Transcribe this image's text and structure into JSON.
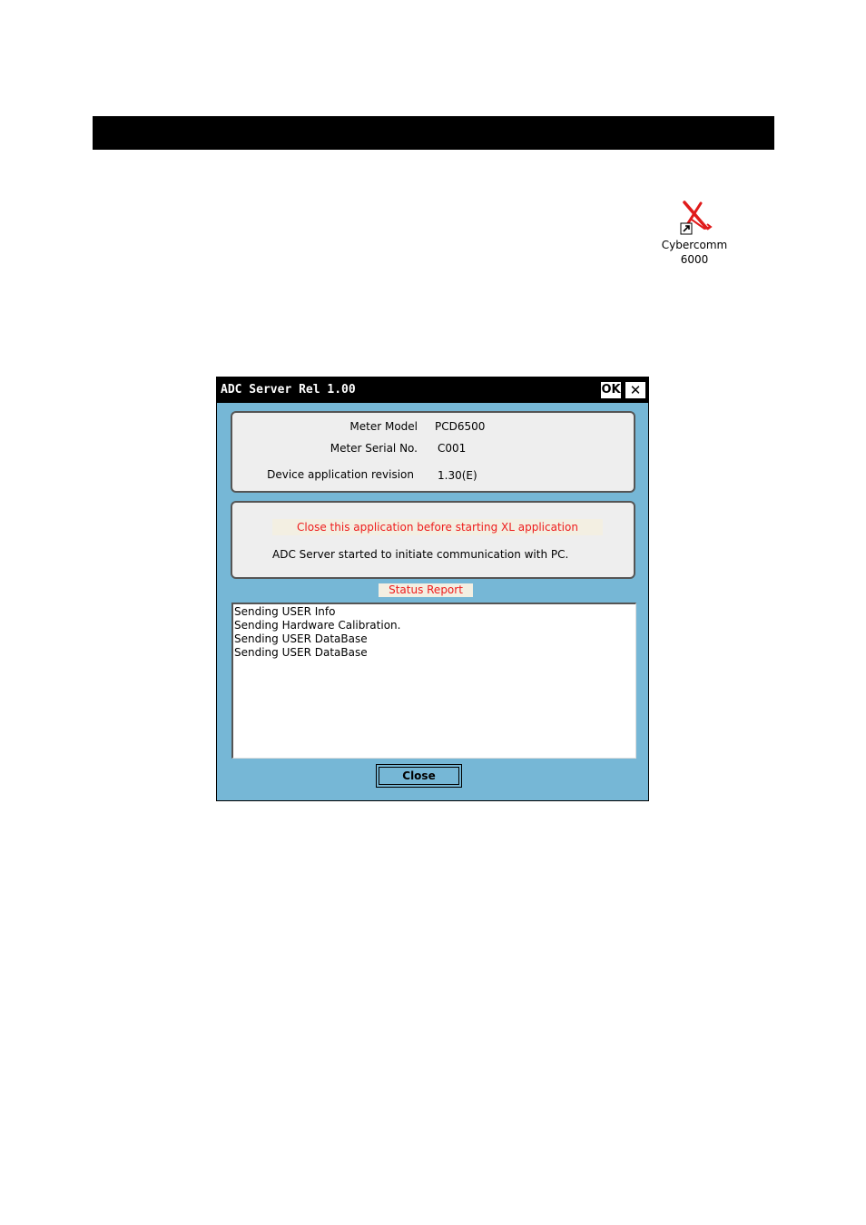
{
  "desktop": {
    "shortcut": {
      "label_line1": "Cybercomm",
      "label_line2": "6000",
      "icon": "cybercomm-shortcut-icon",
      "icon_color": "#e01b1b"
    }
  },
  "window": {
    "title": "ADC Server Rel 1.00",
    "ok_label": "OK",
    "close_glyph": "✕",
    "background_color": "#76b7d6"
  },
  "device_info": {
    "meter_model_label": "Meter Model",
    "meter_model_value": "PCD6500",
    "serial_label": "Meter Serial No.",
    "serial_value": "C001",
    "revision_label": "Device application revision",
    "revision_value": "1.30(E)"
  },
  "messages": {
    "warning": "Close this application before starting XL application",
    "warning_color": "#ee1c1c",
    "started": "ADC Server started to initiate communication with PC."
  },
  "status": {
    "label": "Status Report",
    "lines": [
      "Sending USER Info",
      "Sending Hardware Calibration.",
      "Sending USER DataBase",
      "Sending USER DataBase"
    ]
  },
  "footer": {
    "close_label": "Close"
  }
}
